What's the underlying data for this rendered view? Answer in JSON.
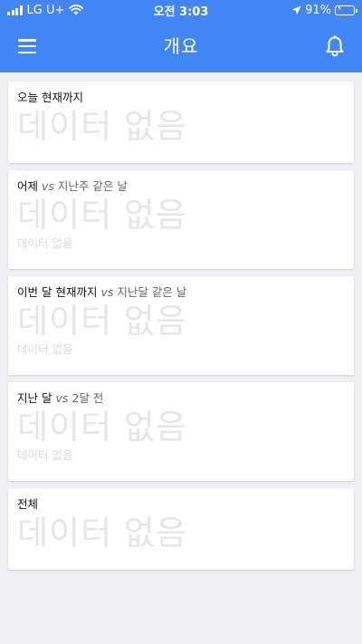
{
  "status_bar": {
    "carrier": "LG U+",
    "time": "오전 3:03",
    "battery": "91%"
  },
  "app_bar": {
    "title": "개요"
  },
  "cards": [
    {
      "title": "오늘 현재까지",
      "value": "데이터 없음"
    },
    {
      "title": "어제",
      "vs": "vs",
      "compare": "지난주 같은 날",
      "value": "데이터 없음",
      "sub": "데이터 없음"
    },
    {
      "title": "이번 달 현재까지",
      "vs": "vs",
      "compare": "지난달 같은 날",
      "value": "데이터 없음",
      "sub": "데이터 없음"
    },
    {
      "title": "지난 달",
      "vs": "vs",
      "compare": "2달 전",
      "value": "데이터 없음",
      "sub": "데이터 없음"
    },
    {
      "title": "전체",
      "value": "데이터 없음"
    }
  ],
  "colors": {
    "primary": "#4285f4",
    "background": "#efeff4",
    "placeholder": "#e6e6e6",
    "battery": "#4cd964"
  }
}
